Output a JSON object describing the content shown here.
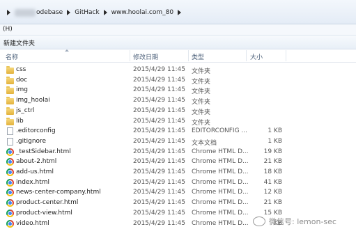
{
  "breadcrumb": [
    "odebase",
    "GitHack",
    "www.hoolai.com_80"
  ],
  "menubar": {
    "label": "(H)"
  },
  "toolbar": {
    "new_folder": "新建文件夹"
  },
  "columns": {
    "name": "名称",
    "date": "修改日期",
    "type": "类型",
    "size": "大小"
  },
  "files": [
    {
      "name": "css",
      "date": "2015/4/29 11:45",
      "type": "文件夹",
      "size": "",
      "icon": "folder-icon"
    },
    {
      "name": "doc",
      "date": "2015/4/29 11:45",
      "type": "文件夹",
      "size": "",
      "icon": "folder-icon"
    },
    {
      "name": "img",
      "date": "2015/4/29 11:45",
      "type": "文件夹",
      "size": "",
      "icon": "folder-icon"
    },
    {
      "name": "img_hoolai",
      "date": "2015/4/29 11:45",
      "type": "文件夹",
      "size": "",
      "icon": "folder-icon"
    },
    {
      "name": "js_ctrl",
      "date": "2015/4/29 11:45",
      "type": "文件夹",
      "size": "",
      "icon": "folder-icon"
    },
    {
      "name": "lib",
      "date": "2015/4/29 11:45",
      "type": "文件夹",
      "size": "",
      "icon": "folder-icon"
    },
    {
      "name": ".editorconfig",
      "date": "2015/4/29 11:45",
      "type": "EDITORCONFIG ...",
      "size": "1 KB",
      "icon": "file-icon"
    },
    {
      "name": ".gitignore",
      "date": "2015/4/29 11:45",
      "type": "文本文档",
      "size": "1 KB",
      "icon": "file-icon"
    },
    {
      "name": "_testSidebar.html",
      "date": "2015/4/29 11:45",
      "type": "Chrome HTML D...",
      "size": "19 KB",
      "icon": "chrome-icon"
    },
    {
      "name": "about-2.html",
      "date": "2015/4/29 11:45",
      "type": "Chrome HTML D...",
      "size": "21 KB",
      "icon": "chrome-icon"
    },
    {
      "name": "add-us.html",
      "date": "2015/4/29 11:45",
      "type": "Chrome HTML D...",
      "size": "18 KB",
      "icon": "chrome-icon"
    },
    {
      "name": "index.html",
      "date": "2015/4/29 11:45",
      "type": "Chrome HTML D...",
      "size": "41 KB",
      "icon": "chrome-icon"
    },
    {
      "name": "news-center-company.html",
      "date": "2015/4/29 11:45",
      "type": "Chrome HTML D...",
      "size": "12 KB",
      "icon": "chrome-icon"
    },
    {
      "name": "product-center.html",
      "date": "2015/4/29 11:45",
      "type": "Chrome HTML D...",
      "size": "21 KB",
      "icon": "chrome-icon"
    },
    {
      "name": "product-view.html",
      "date": "2015/4/29 11:45",
      "type": "Chrome HTML D...",
      "size": "15 KB",
      "icon": "chrome-icon"
    },
    {
      "name": "video.html",
      "date": "2015/4/29 11:45",
      "type": "Chrome HTML D...",
      "size": "KB",
      "icon": "chrome-icon"
    }
  ],
  "watermark": "微信号: lemon-sec"
}
